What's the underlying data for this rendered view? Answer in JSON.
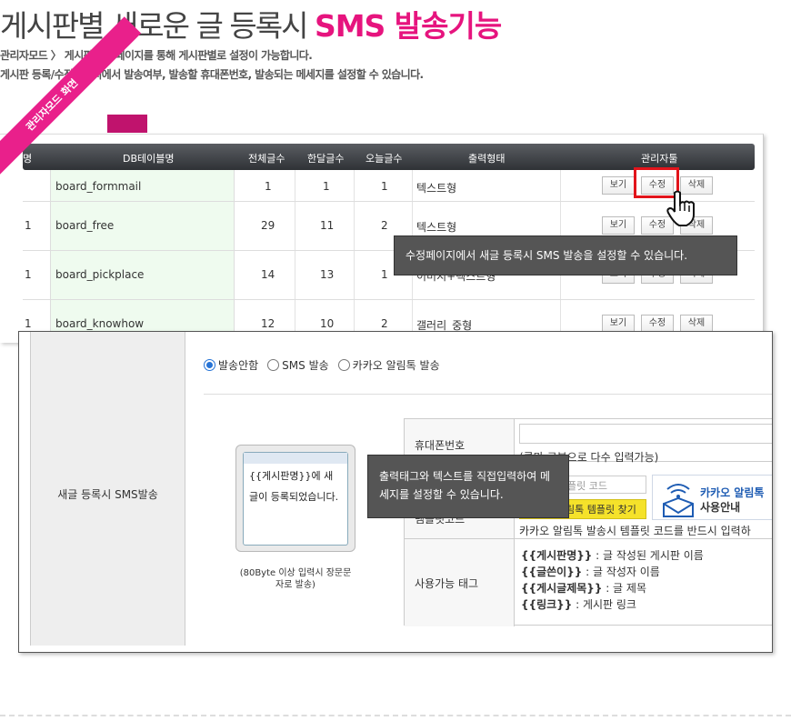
{
  "header": {
    "title_plain": "게시판별 새로운 글 등록시",
    "title_highlight": "SMS 발송기능",
    "desc_line1": "관리자모드 〉 게시판관리 페이지를 통해 게시판별로 설정이 가능합니다.",
    "desc_line2": "게시판 등록/수정페이지에서 발송여부, 발송할 휴대폰번호, 발송되는 메세지를 설정할 수 있습니다."
  },
  "ribbon_label": "관리자모드 화면",
  "table": {
    "headers": [
      "명",
      "DB테이블명",
      "전체글수",
      "한달글수",
      "오늘글수",
      "출력형태",
      "관리자툴"
    ],
    "rows": [
      {
        "prefix": "",
        "db": "board_formmail",
        "total": "1",
        "month": "1",
        "today": "1",
        "type": "텍스트형"
      },
      {
        "prefix": "1",
        "db": "board_free",
        "total": "29",
        "month": "11",
        "today": "2",
        "type": "텍스트형"
      },
      {
        "prefix": "1",
        "db": "board_pickplace",
        "total": "14",
        "month": "13",
        "today": "1",
        "type": "이미지+텍스트형"
      },
      {
        "prefix": "1",
        "db": "board_knowhow",
        "total": "12",
        "month": "10",
        "today": "2",
        "type": "갤러리_중형"
      }
    ],
    "btn_view": "보기",
    "btn_edit": "수정",
    "btn_delete": "삭제"
  },
  "tooltip_edit": "수정페이지에서 새글 등록시 SMS 발송을 설정할 수 있습니다.",
  "form": {
    "row_label": "새글 등록시 SMS발송",
    "radios": [
      {
        "label": "발송안함",
        "checked": true
      },
      {
        "label": "SMS 발송",
        "checked": false
      },
      {
        "label": "카카오 알림톡 발송",
        "checked": false
      }
    ],
    "phone_message": "{{게시판명}}에 새글이 등록되었습니다.",
    "phone_note": "(80Byte 이상 입력시 장문문자로 발송)",
    "tooltip_message": "출력태그와 텍스트를 직접입력하여 메세지를 설정할 수 있습니다.",
    "mobile_label": "휴대폰번호",
    "mobile_hint": "(콤마 구분으로 다수 입력가능)",
    "template_label": "템플릿코드",
    "template_placeholder": "알림톡 템플릿 코드",
    "template_button": "카카오 알림톡 템플릿 찾기",
    "kakao_title": "카카오 알림톡",
    "kakao_sub": "사용안내",
    "template_note": "카카오 알림톡 발송시 템플릿 코드를 반드시 입력하",
    "tags_label": "사용가능 태그",
    "tags": [
      {
        "tag": "{{게시판명}}",
        "desc": " : 글 작성된 게시판 이름"
      },
      {
        "tag": "{{글쓴이}}",
        "desc": " : 글 작성자 이름"
      },
      {
        "tag": "{{게시글제목}}",
        "desc": " : 글 제목"
      },
      {
        "tag": "{{링크}}",
        "desc": " : 게시판 링크"
      }
    ]
  },
  "colors": {
    "accent": "#e6147e",
    "highlight_box": "#e2141b",
    "radio_on": "#2673d6",
    "tooltip_bg": "#555555"
  }
}
